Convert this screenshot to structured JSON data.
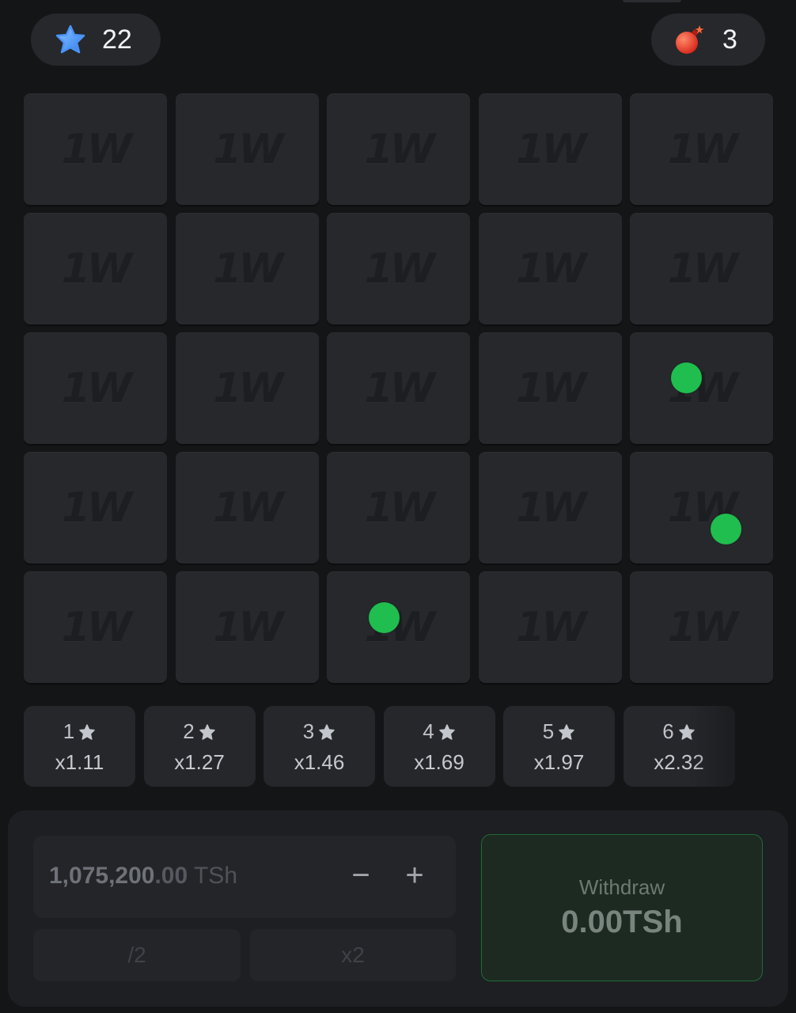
{
  "header": {
    "stars_count": "22",
    "mines_count": "3"
  },
  "grid": {
    "rows": 5,
    "cols": 5,
    "tile_logo": "1W",
    "markers": [
      {
        "row": 2,
        "col": 4
      },
      {
        "row": 3,
        "col": 4
      },
      {
        "row": 4,
        "col": 2
      }
    ]
  },
  "multipliers": [
    {
      "count": "1",
      "value": "x1.11"
    },
    {
      "count": "2",
      "value": "x1.27"
    },
    {
      "count": "3",
      "value": "x1.46"
    },
    {
      "count": "4",
      "value": "x1.69"
    },
    {
      "count": "5",
      "value": "x1.97"
    },
    {
      "count": "6",
      "value": "x2.32"
    }
  ],
  "bet": {
    "amount_int": "1,075,200",
    "amount_dec": ".00",
    "currency": " TSh",
    "minus_label": "−",
    "plus_label": "+",
    "half_label": "/2",
    "double_label": "x2"
  },
  "withdraw": {
    "label": "Withdraw",
    "amount": "0.00TSh"
  },
  "colors": {
    "background": "#141517",
    "tile": "#26282c",
    "marker_green": "#1fbe4e",
    "withdraw_border": "#1f6b39"
  }
}
